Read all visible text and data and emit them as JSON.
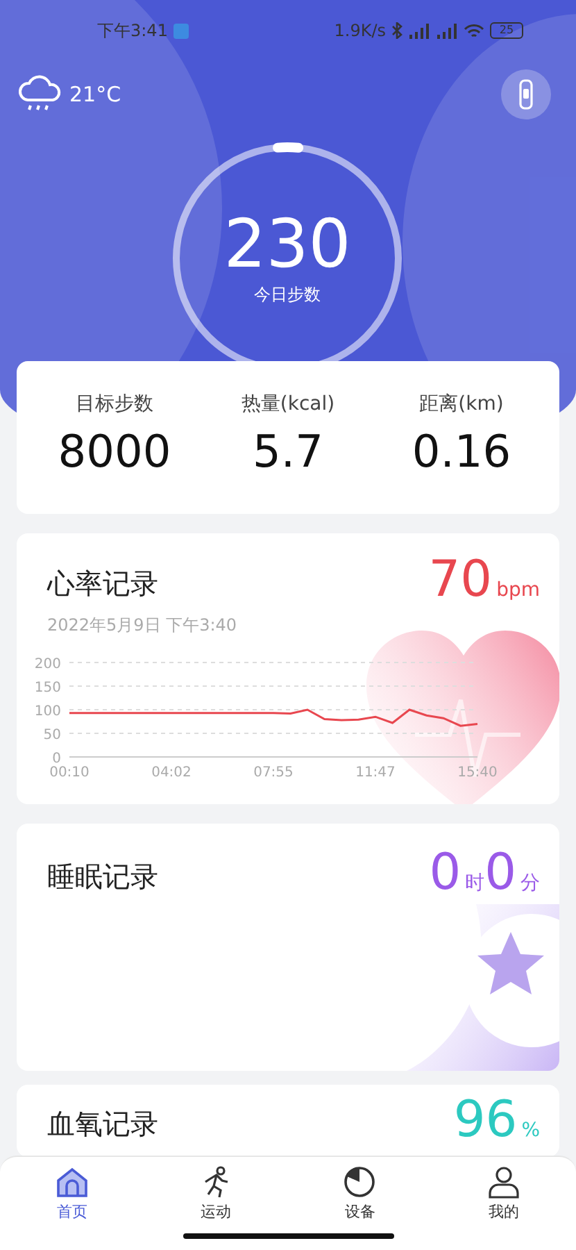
{
  "status_bar": {
    "time": "下午3:41",
    "speed": "1.9K/s",
    "battery": "25"
  },
  "weather": {
    "temperature": "21°C"
  },
  "steps": {
    "value": "230",
    "label": "今日步数",
    "level": 0.03
  },
  "stats": [
    {
      "label": "目标步数",
      "value": "8000"
    },
    {
      "label": "热量(kcal)",
      "value": "5.7"
    },
    {
      "label": "距离(km)",
      "value": "0.16"
    }
  ],
  "heart_rate": {
    "title": "心率记录",
    "value": "70",
    "unit": "bpm",
    "date": "2022年5月9日 下午3:40",
    "chart_data": {
      "type": "line",
      "categories": [
        "00:10",
        null,
        null,
        null,
        null,
        null,
        "04:02",
        null,
        null,
        null,
        null,
        null,
        "07:55",
        null,
        null,
        null,
        null,
        null,
        "11:47",
        null,
        null,
        null,
        null,
        null,
        "15:40"
      ],
      "ylim": [
        0,
        200
      ],
      "grid": true,
      "yticks": [
        0,
        50,
        100,
        150,
        200
      ],
      "series": [
        {
          "color": "#e8474f",
          "values": [
            93,
            93,
            93,
            93,
            93,
            93,
            93,
            93,
            93,
            93,
            93,
            93,
            93,
            92,
            100,
            80,
            78,
            79,
            85,
            72,
            100,
            88,
            82,
            66,
            70
          ]
        }
      ]
    }
  },
  "sleep": {
    "title": "睡眠记录",
    "hours": "0",
    "hours_unit": "时",
    "minutes": "0",
    "minutes_unit": "分"
  },
  "blood_oxygen": {
    "title": "血氧记录",
    "value": "96",
    "unit": "%"
  },
  "tabs": [
    {
      "label": "首页",
      "selected": true
    },
    {
      "label": "运动",
      "selected": false
    },
    {
      "label": "设备",
      "selected": false
    },
    {
      "label": "我的",
      "selected": false
    }
  ]
}
